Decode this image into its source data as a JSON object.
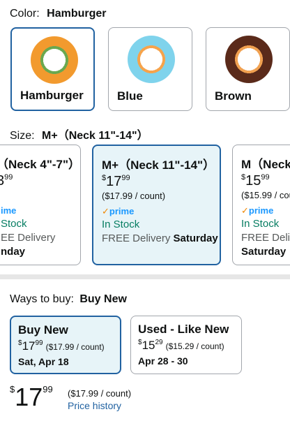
{
  "color_section": {
    "label": "Color:",
    "selected": "Hamburger",
    "options": [
      {
        "name": "Hamburger",
        "base": "#f29a2e",
        "inner": "#6aa84f"
      },
      {
        "name": "Blue",
        "base": "#7fd3ec",
        "inner": "#f6a34b"
      },
      {
        "name": "Brown",
        "base": "#5a2a1a",
        "inner": "#f0a050"
      }
    ]
  },
  "size_section": {
    "label": "Size:",
    "selected": "M+（Neck 11\"-14\"）",
    "cards": [
      {
        "title": "（Neck 4\"-7\"）",
        "price_sym": "",
        "price_whole": "3",
        "price_frac": "99",
        "unit": "",
        "prime": "ime",
        "stock": "Stock",
        "delivery": "EE Delivery",
        "delivery_day": "nday"
      },
      {
        "title": "M+（Neck 11\"-14\"）",
        "price_sym": "$",
        "price_whole": "17",
        "price_frac": "99",
        "unit": "($17.99 / count)",
        "prime": "prime",
        "stock": "In Stock",
        "delivery": "FREE Delivery",
        "delivery_day": "Saturday"
      },
      {
        "title": "M（Neck",
        "price_sym": "$",
        "price_whole": "15",
        "price_frac": "99",
        "unit": "($15.99 / cou",
        "prime": "prime",
        "stock": "In Stock",
        "delivery": "FREE Delive",
        "delivery_day": "Saturday"
      }
    ]
  },
  "ways": {
    "label": "Ways to buy:",
    "selected": "Buy New",
    "options": [
      {
        "title": "Buy New",
        "price_whole": "17",
        "price_frac": "99",
        "unit": "($17.99 / count)",
        "date": "Sat, Apr 18"
      },
      {
        "title": "Used - Like New",
        "price_whole": "15",
        "price_frac": "29",
        "unit": "($15.29 / count)",
        "date": "Apr 28 - 30"
      }
    ]
  },
  "summary": {
    "sym": "$",
    "whole": "17",
    "frac": "99",
    "unit": "($17.99 / count)",
    "history_link": "Price history"
  }
}
